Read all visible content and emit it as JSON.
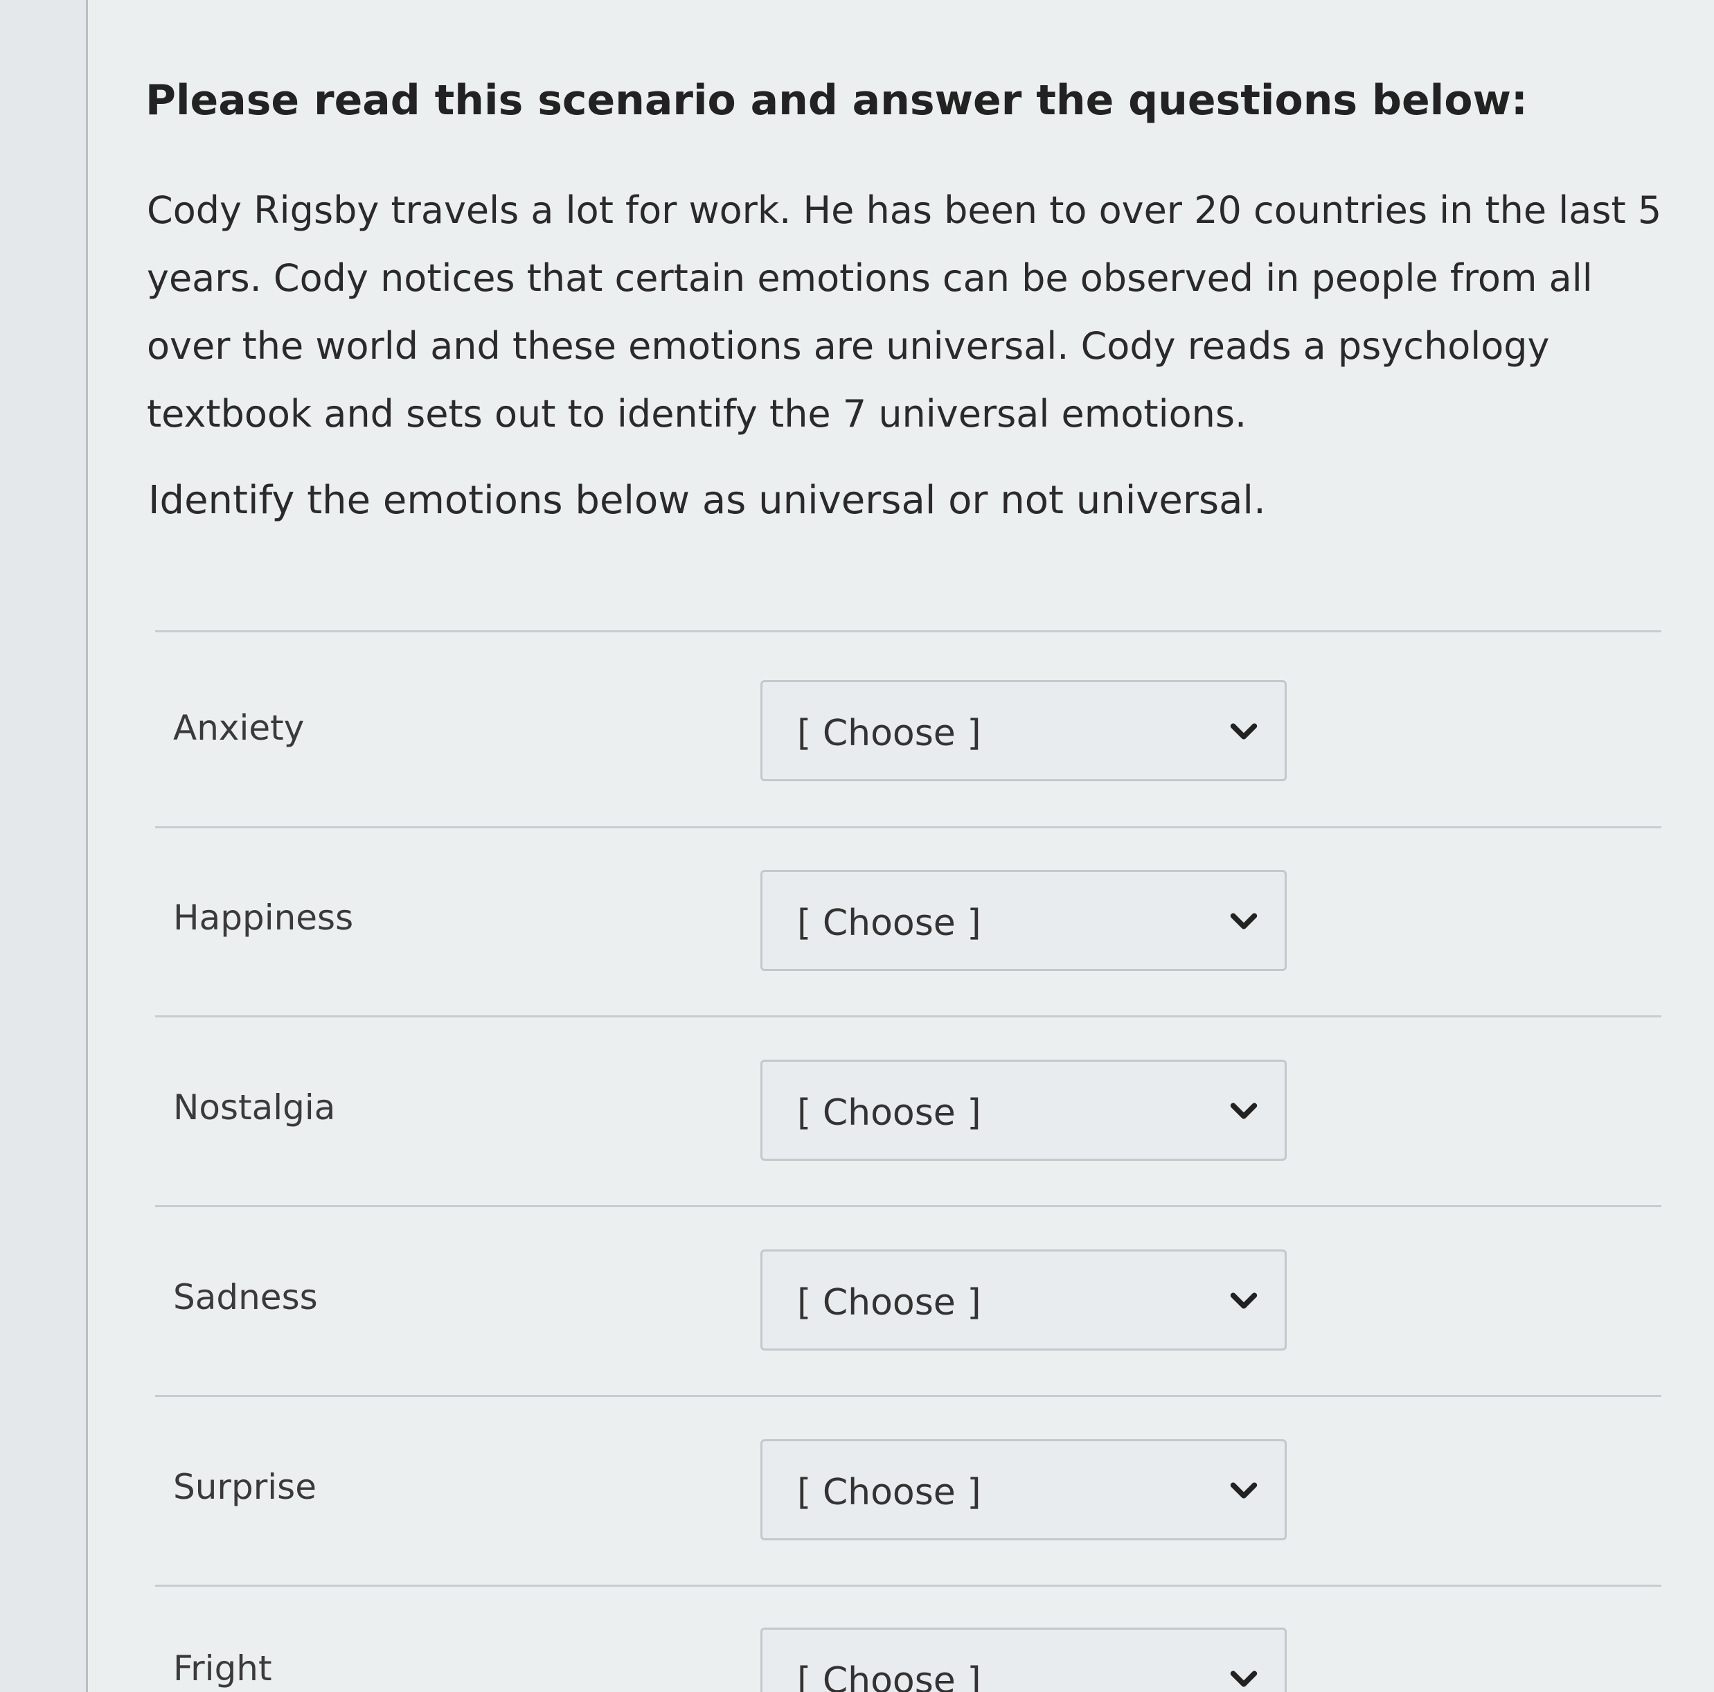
{
  "question": {
    "heading": "Please read this scenario and answer the questions below:",
    "scenario": "Cody Rigsby travels a lot for work. He has been to over 20 countries in the last 5 years. Cody notices that certain emotions can be observed in people from all over the world and these emotions are universal. Cody reads a psychology textbook and sets out to identify the 7 universal emotions.",
    "instruction": "Identify the emotions below as universal or not universal."
  },
  "items": [
    {
      "label": "Anxiety",
      "selected": "[ Choose ]"
    },
    {
      "label": "Happiness",
      "selected": "[ Choose ]"
    },
    {
      "label": "Nostalgia",
      "selected": "[ Choose ]"
    },
    {
      "label": "Sadness",
      "selected": "[ Choose ]"
    },
    {
      "label": "Surprise",
      "selected": "[ Choose ]"
    },
    {
      "label": "Fright",
      "selected": "[ Choose ]"
    }
  ],
  "icons": {
    "dropdown": "chevron-down-icon"
  }
}
